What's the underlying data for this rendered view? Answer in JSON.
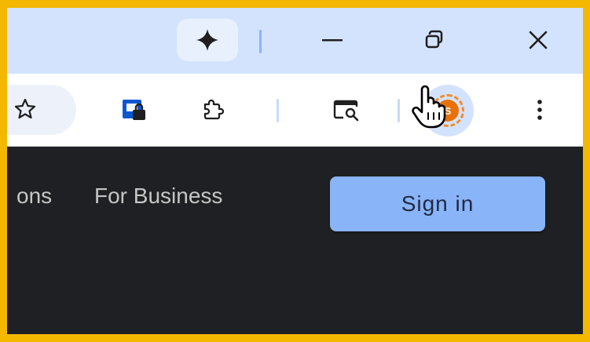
{
  "titlebar": {
    "gemini_icon": "gemini-sparkle-icon",
    "minimize_icon": "minimize-icon",
    "maximize_icon": "restore-icon",
    "close_icon": "close-icon"
  },
  "toolbar": {
    "bookmark_icon": "star-icon",
    "password_icon": "password-manager-icon",
    "extensions_icon": "puzzle-icon",
    "lens_icon": "search-screen-icon",
    "profile_initial": "S",
    "menu_icon": "more-vert-icon"
  },
  "page": {
    "nav_partial_label": "ons",
    "nav_business_label": "For Business",
    "signin_label": "Sign in"
  },
  "colors": {
    "highlight_border": "#f5b800",
    "titlebar_bg": "#d3e3fd",
    "page_bg": "#1f2023",
    "signin_bg": "#8ab4f8",
    "avatar_bg": "#e8710a"
  }
}
